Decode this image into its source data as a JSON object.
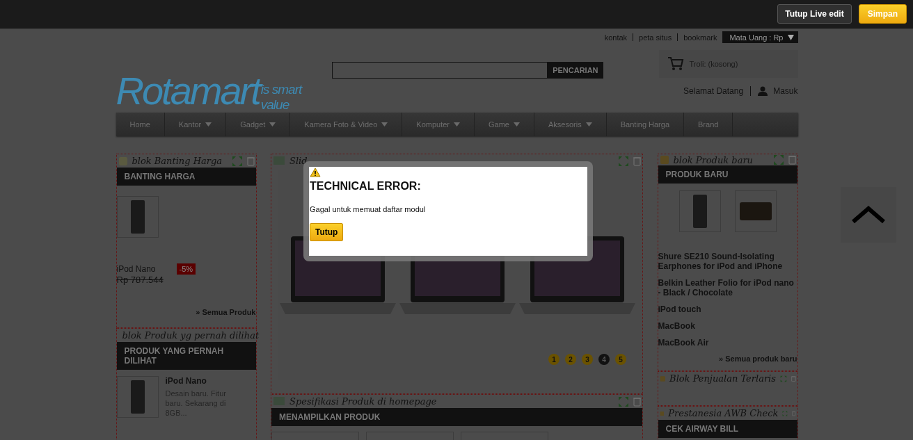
{
  "top_bar": {
    "buttons": [
      {
        "label": "Tutup Live edit",
        "kind": "secondary"
      },
      {
        "label": "Simpan",
        "kind": "primary"
      }
    ]
  },
  "header": {
    "top_links": [
      "kontak",
      "peta situs",
      "bookmark"
    ],
    "currency": "Mata Uang : Rp",
    "logo": {
      "name": "Rotamart",
      "tagline": "is smart value"
    },
    "search": {
      "button": "PENCARIAN"
    },
    "cart": "Troli: (kosong)",
    "welcome": "Selamat Datang",
    "login": "Masuk"
  },
  "nav": [
    {
      "label": "Home",
      "dropdown": false
    },
    {
      "label": "Kantor",
      "dropdown": true
    },
    {
      "label": "Gadget",
      "dropdown": true
    },
    {
      "label": "Kamera Foto & Video",
      "dropdown": true
    },
    {
      "label": "Komputer",
      "dropdown": true
    },
    {
      "label": "Game",
      "dropdown": true
    },
    {
      "label": "Aksesoris",
      "dropdown": true
    },
    {
      "label": "Banting Harga",
      "dropdown": false
    },
    {
      "label": "Brand",
      "dropdown": false
    }
  ],
  "left_column": [
    {
      "editor_title": "blok Banting Harga",
      "title": "BANTING HARGA",
      "product": {
        "name": "iPod Nano",
        "discount": "-5%",
        "old_price": "Rp 787.544"
      },
      "link": "» Semua Produk"
    },
    {
      "editor_title": "blok Produk yg pernah dilihat",
      "title": "PRODUK YANG PERNAH DILIHAT",
      "items": [
        {
          "name": "iPod Nano",
          "description": "Desain baru. Fitur baru. Sekarang di 8GB..."
        }
      ]
    }
  ],
  "center_column": [
    {
      "editor_title": "Slid",
      "pager": [
        {
          "label": "1",
          "selected": false
        },
        {
          "label": "2",
          "selected": false
        },
        {
          "label": "3",
          "selected": false
        },
        {
          "label": "4",
          "selected": true
        },
        {
          "label": "5",
          "selected": false
        }
      ]
    },
    {
      "editor_title": "Spesifikasi Produk di homepage",
      "title": "MENAMPILKAN PRODUK"
    }
  ],
  "right_column": [
    {
      "editor_title": "blok Produk baru",
      "title": "PRODUK BARU",
      "products": [
        "Shure SE210 Sound-Isolating Earphones for iPod and iPhone",
        "Belkin Leather Folio for iPod nano - Black / Chocolate",
        "iPod touch",
        "MacBook",
        "MacBook Air"
      ],
      "link": "» Semua produk baru"
    },
    {
      "editor_title": "Blok Penjualan Terlaris"
    },
    {
      "editor_title": "Prestanesia AWB Check",
      "title": "CEK AIRWAY BILL"
    }
  ],
  "modal": {
    "title": "TECHNICAL ERROR:",
    "message": "Gagal untuk memuat daftar modul",
    "button": "Tutup"
  }
}
